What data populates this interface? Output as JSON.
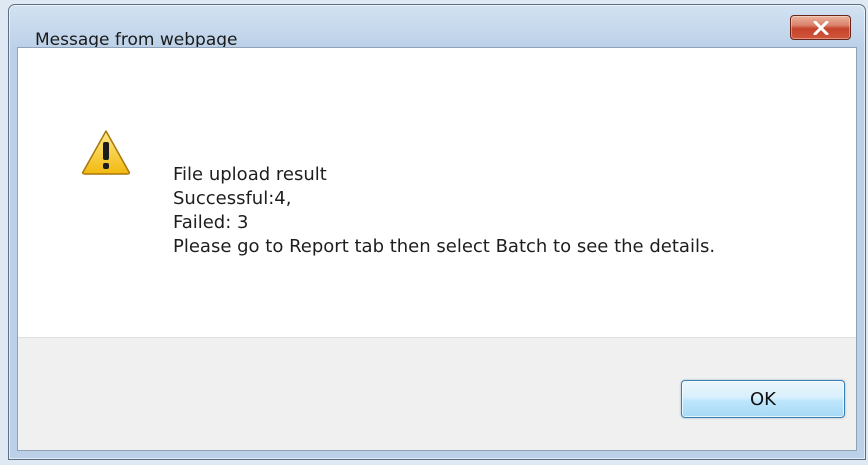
{
  "window": {
    "title": "Message from webpage"
  },
  "controls": {
    "close_icon": "close-x-icon"
  },
  "icon": {
    "name": "warning-icon",
    "color": "#f2c11b"
  },
  "message": {
    "line1": "File upload result",
    "line2": "Successful:4,",
    "line3": "Failed: 3",
    "line4": "Please go to Report tab then select Batch to see the details."
  },
  "buttons": {
    "ok_label": "OK"
  },
  "colors": {
    "close_button": "#c6432b",
    "ok_button_border": "#3c7fb1"
  }
}
